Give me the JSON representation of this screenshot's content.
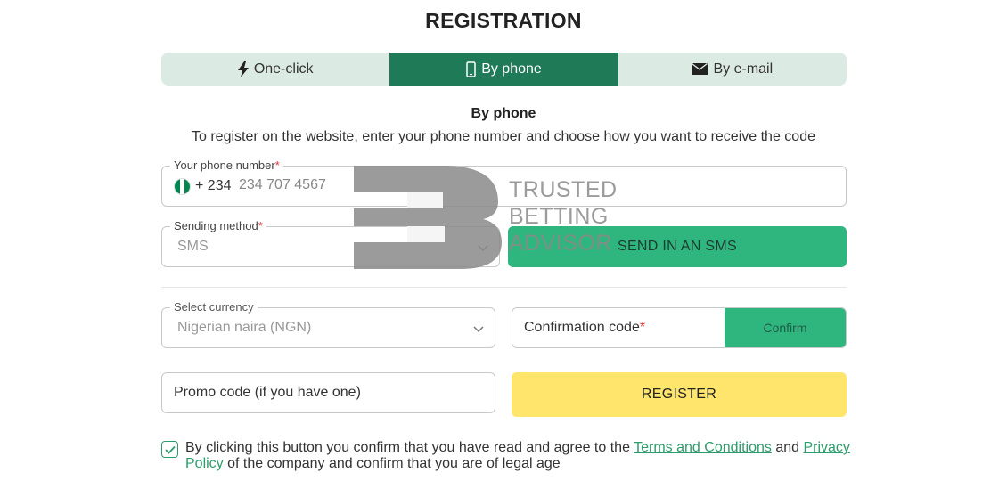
{
  "title": "REGISTRATION",
  "tabs": [
    {
      "label": "One-click",
      "icon": "lightning-icon",
      "active": false
    },
    {
      "label": "By phone",
      "icon": "phone-icon",
      "active": true
    },
    {
      "label": "By e-mail",
      "icon": "envelope-icon",
      "active": false
    }
  ],
  "section": {
    "title": "By phone",
    "description": "To register on the website, enter your phone number and choose how you want to receive the code"
  },
  "phone": {
    "label": "Your phone number",
    "required_mark": "*",
    "country_code": "+ 234",
    "placeholder": "234 707 4567",
    "flag_colors": [
      "#008751",
      "#ffffff",
      "#008751"
    ]
  },
  "sending_method": {
    "label": "Sending method",
    "required_mark": "*",
    "value": "SMS"
  },
  "send_sms_button": "SEND IN AN SMS",
  "currency": {
    "label": "Select currency",
    "value": "Nigerian naira (NGN)"
  },
  "confirmation": {
    "label": "Confirmation code",
    "required_mark": "*",
    "button": "Confirm"
  },
  "promo": {
    "placeholder": "Promo code (if you have one)"
  },
  "register_button": "REGISTER",
  "agreement": {
    "checked": true,
    "text_before": "By clicking this button you confirm that you have read and agree to the ",
    "terms_link": "Terms and Conditions",
    "text_and": " and ",
    "privacy_link": "Privacy Policy",
    "text_after": " of the company and confirm that you are of legal age"
  },
  "watermark": {
    "line1": "TRUSTED",
    "line2": "BETTING",
    "line3": "ADVISOR"
  },
  "colors": {
    "accent_dark": "#1f7a58",
    "accent": "#2fb57e",
    "tab_bg": "#dbeae3",
    "register": "#ffe56c",
    "required": "#e0343a"
  }
}
